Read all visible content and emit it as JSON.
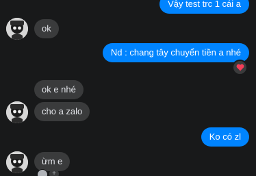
{
  "messages": {
    "m1": "Vậy test trc 1 cái a",
    "m2": "ok",
    "m3": "Nd : chang tây chuyển tiền a nhé",
    "m4": "ok e nhé",
    "m5": "cho a zalo",
    "m6": "Ko có zl",
    "m7": "ừm e"
  },
  "reaction": {
    "icon": "heart-icon",
    "color": "#f33e58"
  },
  "seen": {
    "more_label": "+"
  },
  "colors": {
    "outgoing_bubble": "#0084ff",
    "incoming_bubble": "#3a3b3c",
    "background": "#18191a"
  }
}
